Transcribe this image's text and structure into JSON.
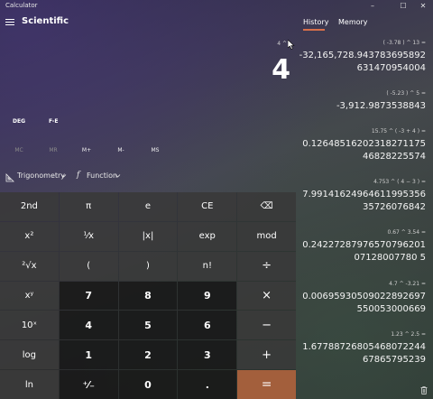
{
  "window": {
    "title": "Calculator",
    "minimize": "–",
    "maximize": "☐",
    "close": "✕"
  },
  "header": {
    "mode_title": "Scientific"
  },
  "display": {
    "expression": "4 ^",
    "result": "4"
  },
  "controls": {
    "angle_unit": "DEG",
    "fe": "F-E"
  },
  "memory": [
    "MC",
    "MR",
    "M+",
    "M-",
    "MS"
  ],
  "toolbar": {
    "trigonometry": "Trigonometry",
    "function": "Function",
    "function_symbol": "f"
  },
  "keypad": {
    "rows": [
      [
        "2nd",
        "π",
        "e",
        "CE",
        "⌫"
      ],
      [
        "x²",
        "¹⁄x",
        "|x|",
        "exp",
        "mod"
      ],
      [
        "²√x",
        "(",
        ")",
        "n!",
        "÷"
      ],
      [
        "xʸ",
        "7",
        "8",
        "9",
        "×"
      ],
      [
        "10ˣ",
        "4",
        "5",
        "6",
        "−"
      ],
      [
        "log",
        "1",
        "2",
        "3",
        "+"
      ],
      [
        "ln",
        "⁺⁄₋",
        "0",
        ".",
        "="
      ]
    ]
  },
  "history_panel": {
    "tabs": [
      "History",
      "Memory"
    ],
    "active_tab": "History",
    "items": [
      {
        "expression": "( -3.78 )  ^  13 =",
        "result": "-32,165,728.943783695892631470954004"
      },
      {
        "expression": "( -5.23 )  ^  5 =",
        "result": "-3,912.9873538843"
      },
      {
        "expression": "15.75  ^  ( -3  +  4 ) =",
        "result": "0.1264851620231827117546828225574"
      },
      {
        "expression": "4.753  ^  ( 4  −  3 ) =",
        "result": "7.9914162496461199535635726076842"
      },
      {
        "expression": "0.67  ^  3.54 =",
        "result": "0.2422728797657079620107128007780 5"
      },
      {
        "expression": "4.7  ^  -3.21 =",
        "result": "0.00695930509022892697550053000669"
      },
      {
        "expression": "1.23  ^  2.5 =",
        "result": "1.67788726805468072244 67865795239"
      }
    ]
  },
  "colors": {
    "accent": "#d66f4a",
    "equals_key": "#a35f3c",
    "number_key": "#191919",
    "function_key": "#3c3c3c"
  }
}
